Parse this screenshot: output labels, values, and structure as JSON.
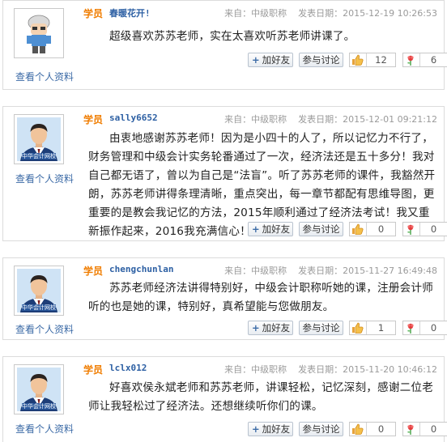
{
  "labels": {
    "profile": "查看个人资料",
    "role": "学员",
    "add_friend": "加好友",
    "discuss": "参与讨论"
  },
  "posts": [
    {
      "username": "春暖花开!",
      "from": "来自：中级职称",
      "date": "发表日期：2015-12-19 10:26:53",
      "content": "超级喜欢苏苏老师，实在太喜欢听苏老师讲课了。",
      "likes": "12",
      "flowers": "6",
      "avatar_badge": ""
    },
    {
      "username": "sally6652",
      "from": "来自：中级职称",
      "date": "发表日期：2015-12-01 09:21:12",
      "content": "由衷地感谢苏苏老师！因为是小四十的人了，所以记忆力不行了，财务管理和中级会计实务轮番通过了一次，经济法还是五十多分！我对自己都无语了，曾以为自己是“法盲”。听了苏苏老师的课件，我豁然开朗，苏苏老师讲得条理清晰，重点突出，每一章节都配有思维导图，更重要的是教会我记忆的方法，2015年顺利通过了经济法考试！我又重新振作起来，2016我充满信心！",
      "likes": "0",
      "flowers": "0",
      "avatar_badge": "中华会计网校"
    },
    {
      "username": "chengchunlan",
      "from": "来自：中级职称",
      "date": "发表日期：2015-11-27 16:49:48",
      "content": "苏苏老师经济法讲得特别好，中级会计职称听她的课，注册会计师听的也是她的课，特别好，真希望能与您做朋友。",
      "likes": "1",
      "flowers": "0",
      "avatar_badge": "中华会计网校"
    },
    {
      "username": "lclx012",
      "from": "来自：中级职称",
      "date": "发表日期：2015-11-20 10:46:12",
      "content": "好喜欢侯永斌老师和苏苏老师，讲课轻松，记忆深刻，感谢二位老师让我轻松过了经济法。还想继续听你们的课。",
      "likes": "0",
      "flowers": "0",
      "avatar_badge": "中华会计网校"
    }
  ]
}
